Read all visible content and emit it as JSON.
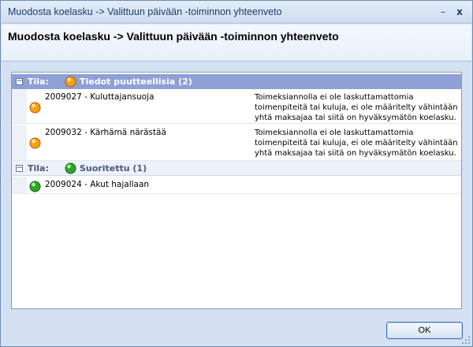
{
  "window": {
    "title": "Muodosta koelasku -> Valittuun päivään -toiminnon yhteenveto",
    "minimize_glyph": "–",
    "close_glyph": "x"
  },
  "header": {
    "title": "Muodosta koelasku -> Valittuun päivään -toiminnon yhteenveto"
  },
  "groups": [
    {
      "label": "Tila:",
      "status": "Tiedot puutteellisia (2)",
      "expander": "−",
      "icon": "warning-status-icon",
      "color": "#f5a11a",
      "rows": [
        {
          "name": "2009027 - Kuluttajansuoja",
          "description": "Toimeksiannolla ei ole laskuttamattomia toimenpiteitä tai kuluja, ei ole määritelty vähintään yhtä maksajaa tai siitä on hyväksymätön koelasku."
        },
        {
          "name": "2009032 - Kärhämä närästää",
          "description": "Toimeksiannolla ei ole laskuttamattomia toimenpiteitä tai kuluja, ei ole määritelty vähintään yhtä maksajaa tai siitä on hyväksymätön koelasku."
        }
      ]
    },
    {
      "label": "Tila:",
      "status": "Suoritettu (1)",
      "expander": "−",
      "icon": "success-status-icon",
      "color": "#2ea52a",
      "rows": [
        {
          "name": "2009024 - Akut hajallaan",
          "description": ""
        }
      ]
    }
  ],
  "footer": {
    "ok_label": "OK"
  }
}
